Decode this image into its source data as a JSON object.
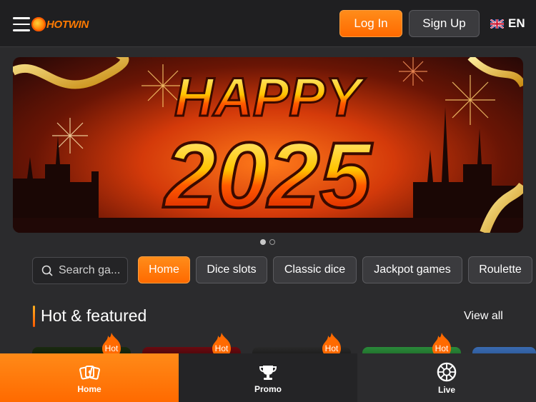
{
  "header": {
    "logo_text": "HOTWIN",
    "login_label": "Log In",
    "signup_label": "Sign Up",
    "language": "EN",
    "language_flag_icon": "uk-flag-icon"
  },
  "banner": {
    "headline": "HAPPY",
    "year": "2025",
    "slides_total": 2,
    "active_slide": 1
  },
  "search": {
    "placeholder": "Search ga..."
  },
  "categories": [
    {
      "label": "Home",
      "active": true
    },
    {
      "label": "Dice slots",
      "active": false
    },
    {
      "label": "Classic dice",
      "active": false
    },
    {
      "label": "Jackpot games",
      "active": false
    },
    {
      "label": "Roulette",
      "active": false
    }
  ],
  "section": {
    "title": "Hot & featured",
    "view_all": "View all",
    "badge": "Hot"
  },
  "bottom_nav": [
    {
      "label": "Home",
      "icon": "cards-icon",
      "active": true
    },
    {
      "label": "Promo",
      "icon": "trophy-icon",
      "active": false
    },
    {
      "label": "Live",
      "icon": "roulette-wheel-icon",
      "active": false
    }
  ],
  "colors": {
    "accent": "#ff6a00",
    "background": "#2b2b2d",
    "header": "#1f1f21"
  }
}
